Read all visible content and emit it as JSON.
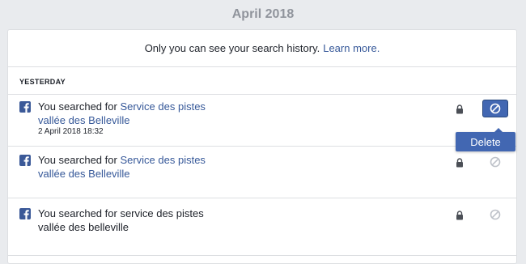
{
  "header": {
    "month": "April 2018"
  },
  "notice": {
    "text": "Only you can see your search history.",
    "link": "Learn more."
  },
  "section": {
    "label": "YESTERDAY"
  },
  "entries": [
    {
      "prefix": "You searched for",
      "query_line1": "Service des pistes",
      "query_line2": "vallée des Belleville",
      "query_is_link": true,
      "date": "2 April 2018 18:32",
      "audience_icon": "lock-icon",
      "action_icon": "ban-icon",
      "action_active": true
    },
    {
      "prefix": "You searched for",
      "query_line1": "Service des pistes",
      "query_line2": "vallée des Belleville",
      "query_is_link": true,
      "audience_icon": "lock-icon",
      "action_icon": "ban-icon",
      "action_active": false
    },
    {
      "prefix": "You searched for",
      "query_line1": "service des pistes",
      "query_line2": "vallée des belleville",
      "query_is_link": false,
      "audience_icon": "lock-icon",
      "action_icon": "ban-icon",
      "action_active": false
    }
  ],
  "popover": {
    "delete_label": "Delete"
  },
  "colors": {
    "brand": "#4267b2",
    "link": "#365899",
    "background": "#e9ebee",
    "muted": "#90949c"
  }
}
